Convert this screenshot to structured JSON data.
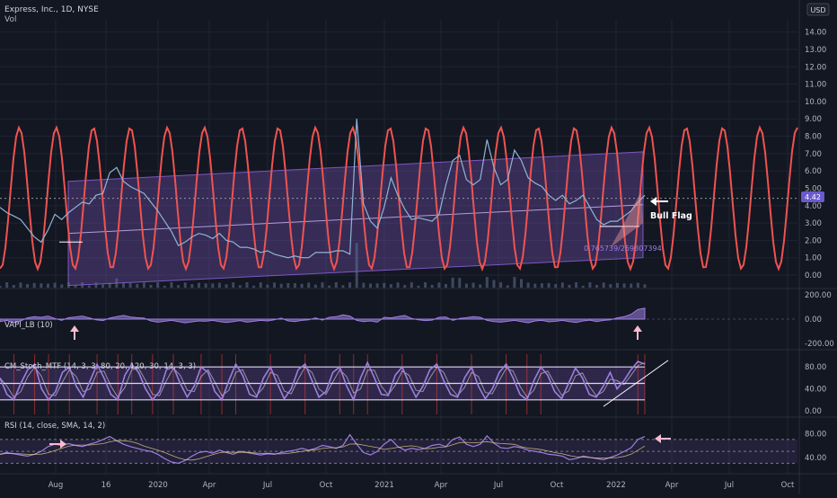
{
  "header": {
    "title": "Express, Inc., 1D, NYSE",
    "vol_label": "Vol",
    "currency_badge": "USD"
  },
  "colors": {
    "background": "#131722",
    "grid": "#1f2433",
    "axis_text": "#b2b5be",
    "price": "#8fb4d6",
    "sine": "#ef5350",
    "channel": "#7e57c2",
    "osc": "#9d7fe0",
    "annotation": "#ffffff",
    "pink_arrow": "#f8bbd0",
    "price_badge": "#6a5acd"
  },
  "annotations": {
    "bull_flag": "Bull Flag",
    "fib_ratio": "0.765739/259807394",
    "current_price": "4.42"
  },
  "chart_data": [
    {
      "type": "line",
      "pane": "price",
      "title": "Express, Inc., 1D, NYSE",
      "y_ticks": [
        "14.00",
        "13.00",
        "12.00",
        "11.00",
        "10.00",
        "9.00",
        "8.00",
        "7.00",
        "6.00",
        "5.00",
        "4.00",
        "3.00",
        "2.00",
        "1.00",
        "0.00"
      ],
      "ylim": [
        0,
        14.5
      ],
      "x_ticks": [
        "Aug",
        "16",
        "2020",
        "Apr",
        "Jul",
        "Oct",
        "2021",
        "Apr",
        "Jul",
        "Oct",
        "2022",
        "Apr",
        "Jul",
        "Oct"
      ],
      "series": [
        {
          "name": "",
          "values": [
            3.9,
            3.6,
            3.4,
            3.2,
            2.7,
            2.2,
            1.9,
            2.6,
            3.5,
            3.2,
            3.6,
            3.9,
            4.2,
            4.1,
            4.6,
            4.7,
            5.9,
            6.2,
            5.4,
            5.1,
            4.9,
            4.7,
            4.2,
            3.7,
            3.1,
            2.5,
            1.7,
            1.9,
            2.2,
            2.4,
            2.3,
            2.1,
            2.4,
            2.0,
            1.9,
            1.6,
            1.6,
            1.5,
            1.3,
            1.4,
            1.2,
            1.1,
            1.0,
            1.1,
            1.0,
            1.0,
            1.3,
            1.3,
            1.3,
            1.4,
            1.4,
            1.2,
            9.0,
            4.1,
            3.1,
            2.7,
            3.9,
            5.6,
            4.6,
            3.8,
            3.2,
            3.3,
            3.2,
            3.1,
            3.5,
            5.2,
            6.6,
            6.9,
            5.5,
            5.2,
            5.5,
            7.8,
            6.2,
            5.2,
            5.5,
            7.2,
            6.6,
            5.6,
            5.3,
            5.1,
            4.6,
            4.3,
            4.6,
            4.1,
            4.3,
            4.6,
            3.9,
            3.2,
            2.9,
            3.1,
            3.1,
            3.4,
            3.7,
            4.2,
            4.6
          ]
        }
      ],
      "channel": {
        "upper_start": 5.4,
        "upper_end": 7.1,
        "lower_start": -0.6,
        "lower_end": 1.0
      },
      "sine_wave": {
        "min": 0.35,
        "max": 8.5,
        "period_points": 5.4
      }
    },
    {
      "type": "area",
      "pane": "VAPI_LB",
      "title": "VAPI_LB (10)",
      "y_ticks": [
        "200.00",
        "0.00",
        "-200.00"
      ],
      "ylim": [
        -200,
        200
      ],
      "values": [
        -20,
        -10,
        -30,
        -15,
        10,
        20,
        15,
        25,
        5,
        -10,
        12,
        18,
        25,
        10,
        -5,
        -12,
        8,
        20,
        30,
        18,
        12,
        8,
        -15,
        -25,
        -18,
        -10,
        -20,
        -30,
        -22,
        -15,
        -18,
        -10,
        -20,
        -28,
        -20,
        -12,
        -25,
        -18,
        -10,
        -15,
        -5,
        8,
        -15,
        -20,
        -10,
        -5,
        10,
        -8,
        15,
        20,
        35,
        25,
        -10,
        -20,
        -15,
        -25,
        15,
        10,
        20,
        30,
        5,
        -5,
        -12,
        -8,
        15,
        18,
        -10,
        5,
        12,
        20,
        15,
        -10,
        -20,
        -25,
        -18,
        -10,
        -20,
        -30,
        -15,
        -10,
        -22,
        -18,
        -10,
        -20,
        -28,
        -15,
        -8,
        -20,
        -10,
        -5,
        10,
        20,
        40,
        80,
        90
      ]
    },
    {
      "type": "line",
      "pane": "CM_Stoch_MTF",
      "title": "CM_Stoch_MTF (14, 3, 3, 80, 20, 120, 30, 14, 3, 3)",
      "y_ticks": [
        "80.00",
        "40.00",
        "0.00"
      ],
      "ylim": [
        0,
        100
      ],
      "levels": [
        80,
        50,
        20
      ],
      "values": [
        60,
        30,
        20,
        50,
        75,
        85,
        40,
        20,
        35,
        70,
        80,
        45,
        25,
        55,
        85,
        60,
        30,
        20,
        65,
        85,
        70,
        40,
        20,
        35,
        75,
        80,
        50,
        25,
        45,
        80,
        70,
        35,
        20,
        55,
        85,
        65,
        30,
        25,
        60,
        80,
        50,
        22,
        40,
        75,
        85,
        55,
        25,
        35,
        70,
        80,
        45,
        20,
        60,
        88,
        60,
        30,
        28,
        65,
        80,
        50,
        25,
        45,
        75,
        85,
        55,
        30,
        25,
        60,
        80,
        45,
        22,
        40,
        70,
        85,
        60,
        30,
        20,
        55,
        80,
        65,
        35,
        22,
        50,
        78,
        60,
        30,
        25,
        45,
        70,
        40,
        55,
        75,
        90,
        85
      ]
    },
    {
      "type": "line",
      "pane": "RSI",
      "title": "RSI (14, close, SMA, 14, 2)",
      "y_ticks": [
        "80.00",
        "40.00"
      ],
      "ylim": [
        20,
        100
      ],
      "levels": [
        70,
        50,
        30
      ],
      "values": [
        45,
        48,
        46,
        44,
        42,
        45,
        50,
        58,
        62,
        60,
        63,
        60,
        58,
        62,
        65,
        70,
        75,
        68,
        62,
        58,
        55,
        52,
        50,
        45,
        38,
        32,
        30,
        35,
        42,
        48,
        50,
        47,
        52,
        48,
        45,
        50,
        48,
        46,
        44,
        46,
        45,
        48,
        50,
        52,
        55,
        52,
        55,
        60,
        58,
        55,
        60,
        78,
        62,
        48,
        44,
        50,
        62,
        70,
        58,
        52,
        55,
        53,
        55,
        60,
        62,
        58,
        70,
        74,
        62,
        58,
        62,
        76,
        64,
        56,
        55,
        58,
        56,
        52,
        50,
        48,
        45,
        44,
        42,
        36,
        38,
        42,
        40,
        38,
        36,
        40,
        44,
        50,
        56,
        70,
        75
      ]
    }
  ]
}
